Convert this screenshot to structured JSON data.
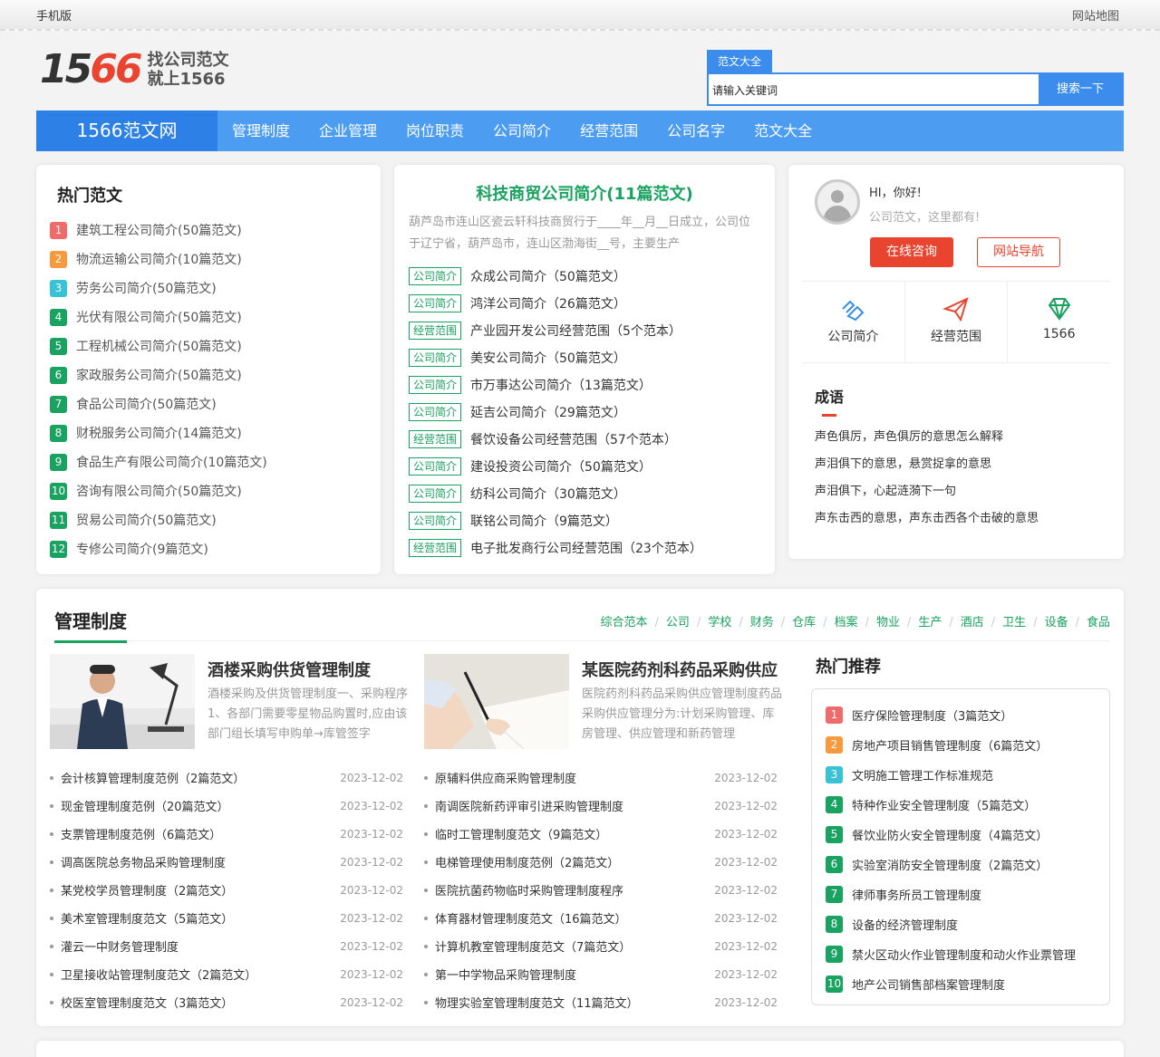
{
  "topbar": {
    "mobile": "手机版",
    "sitemap": "网站地图"
  },
  "logo": {
    "num_a": "15",
    "num_b": "66",
    "slogan_1": "找公司范文",
    "slogan_2": "就上1566"
  },
  "search": {
    "tab": "范文大全",
    "placeholder": "请输入关键词",
    "button": "搜索一下"
  },
  "nav": {
    "brand": "1566范文网",
    "items": [
      "管理制度",
      "企业管理",
      "岗位职责",
      "公司简介",
      "经营范围",
      "公司名字",
      "范文大全"
    ]
  },
  "hot": {
    "title": "热门范文",
    "items": [
      {
        "n": "1",
        "text": "建筑工程公司简介(50篇范文)"
      },
      {
        "n": "2",
        "text": "物流运输公司简介(10篇范文)"
      },
      {
        "n": "3",
        "text": "劳务公司简介(50篇范文)"
      },
      {
        "n": "4",
        "text": "光伏有限公司简介(50篇范文)"
      },
      {
        "n": "5",
        "text": "工程机械公司简介(50篇范文)"
      },
      {
        "n": "6",
        "text": "家政服务公司简介(50篇范文)"
      },
      {
        "n": "7",
        "text": "食品公司简介(50篇范文)"
      },
      {
        "n": "8",
        "text": "财税服务公司简介(14篇范文)"
      },
      {
        "n": "9",
        "text": "食品生产有限公司简介(10篇范文)"
      },
      {
        "n": "10",
        "text": "咨询有限公司简介(50篇范文)"
      },
      {
        "n": "11",
        "text": "贸易公司简介(50篇范文)"
      },
      {
        "n": "12",
        "text": "专修公司简介(9篇范文)"
      }
    ],
    "colors": [
      "#f06a6a",
      "#f79a3e",
      "#37c2d6",
      "#1aa260",
      "#1aa260",
      "#1aa260",
      "#1aa260",
      "#1aa260",
      "#1aa260",
      "#1aa260",
      "#1aa260",
      "#1aa260"
    ]
  },
  "featured": {
    "title": "科技商贸公司简介(11篇范文)",
    "desc": "葫芦岛市连山区瓷云轩科技商贸行于____年__月__日成立，公司位于辽宁省，葫芦岛市，连山区渤海街__号，主要生产",
    "items": [
      {
        "tag": "公司简介",
        "text": "众成公司简介（50篇范文）"
      },
      {
        "tag": "公司简介",
        "text": "鸿洋公司简介（26篇范文）"
      },
      {
        "tag": "经营范围",
        "text": "产业园开发公司经营范围（5个范本）"
      },
      {
        "tag": "公司简介",
        "text": "美安公司简介（50篇范文）"
      },
      {
        "tag": "公司简介",
        "text": "市万事达公司简介（13篇范文）"
      },
      {
        "tag": "公司简介",
        "text": "延吉公司简介（29篇范文）"
      },
      {
        "tag": "经营范围",
        "text": "餐饮设备公司经营范围（57个范本）"
      },
      {
        "tag": "公司简介",
        "text": "建设投资公司简介（50篇范文）"
      },
      {
        "tag": "公司简介",
        "text": "纺科公司简介（30篇范文）"
      },
      {
        "tag": "公司简介",
        "text": "联铭公司简介（9篇范文）"
      },
      {
        "tag": "经营范围",
        "text": "电子批发商行公司经营范围（23个范本）"
      }
    ]
  },
  "user": {
    "hi": "HI，你好!",
    "sub": "公司范文，这里都有!",
    "consult": "在线咨询",
    "navigate": "网站导航",
    "quick": [
      {
        "label": "公司简介",
        "icon": "handshake-icon"
      },
      {
        "label": "经营范围",
        "icon": "paper-plane-icon"
      },
      {
        "label": "1566",
        "icon": "diamond-icon"
      }
    ],
    "idiom_title": "成语",
    "idioms": [
      "声色俱厉，声色俱厉的意思怎么解释",
      "声泪俱下的意思，悬赏捉拿的意思",
      "声泪俱下，心起涟漪下一句",
      "声东击西的意思，声东击西各个击破的意思"
    ]
  },
  "mgmt": {
    "title": "管理制度",
    "cats": [
      "综合范本",
      "公司",
      "学校",
      "财务",
      "仓库",
      "档案",
      "物业",
      "生产",
      "酒店",
      "卫生",
      "设备",
      "食品"
    ],
    "feat": [
      {
        "title": "酒楼采购供货管理制度",
        "text": "酒楼采购及供货管理制度一、采购程序1、各部门需要零星物品购置时,应由该部门组长填写申购单→库管签字"
      },
      {
        "title": "某医院药剂科药品采购供应",
        "text": "医院药剂科药品采购供应管理制度药品采购供应管理分为:计划采购管理、库房管理、供应管理和新药管理"
      }
    ],
    "list_left": [
      {
        "t": "会计核算管理制度范例（2篇范文）",
        "d": "2023-12-02"
      },
      {
        "t": "现金管理制度范例（20篇范文）",
        "d": "2023-12-02"
      },
      {
        "t": "支票管理制度范例（6篇范文）",
        "d": "2023-12-02"
      },
      {
        "t": "调高医院总务物品采购管理制度",
        "d": "2023-12-02"
      },
      {
        "t": "某党校学员管理制度（2篇范文）",
        "d": "2023-12-02"
      },
      {
        "t": "美术室管理制度范文（5篇范文）",
        "d": "2023-12-02"
      },
      {
        "t": "灌云一中财务管理制度",
        "d": "2023-12-02"
      },
      {
        "t": "卫星接收站管理制度范文（2篇范文）",
        "d": "2023-12-02"
      },
      {
        "t": "校医室管理制度范文（3篇范文）",
        "d": "2023-12-02"
      }
    ],
    "list_right": [
      {
        "t": "原辅料供应商采购管理制度",
        "d": "2023-12-02"
      },
      {
        "t": "南调医院新药评审引进采购管理制度",
        "d": "2023-12-02"
      },
      {
        "t": "临时工管理制度范文（9篇范文）",
        "d": "2023-12-02"
      },
      {
        "t": "电梯管理使用制度范例（2篇范文）",
        "d": "2023-12-02"
      },
      {
        "t": "医院抗菌药物临时采购管理制度程序",
        "d": "2023-12-02"
      },
      {
        "t": "体育器材管理制度范文（16篇范文）",
        "d": "2023-12-02"
      },
      {
        "t": "计算机教室管理制度范文（7篇范文）",
        "d": "2023-12-02"
      },
      {
        "t": "第一中学物品采购管理制度",
        "d": "2023-12-02"
      },
      {
        "t": "物理实验室管理制度范文（11篇范文）",
        "d": "2023-12-02"
      }
    ],
    "rec_title": "热门推荐",
    "rec": [
      {
        "n": "1",
        "t": "医疗保险管理制度（3篇范文）"
      },
      {
        "n": "2",
        "t": "房地产项目销售管理制度（6篇范文）"
      },
      {
        "n": "3",
        "t": "文明施工管理工作标准规范"
      },
      {
        "n": "4",
        "t": "特种作业安全管理制度（5篇范文）"
      },
      {
        "n": "5",
        "t": "餐饮业防火安全管理制度（4篇范文）"
      },
      {
        "n": "6",
        "t": "实验室消防安全管理制度（2篇范文）"
      },
      {
        "n": "7",
        "t": "律师事务所员工管理制度"
      },
      {
        "n": "8",
        "t": "设备的经济管理制度"
      },
      {
        "n": "9",
        "t": "禁火区动火作业管理制度和动火作业票管理"
      },
      {
        "n": "10",
        "t": "地产公司销售部档案管理制度"
      }
    ]
  }
}
